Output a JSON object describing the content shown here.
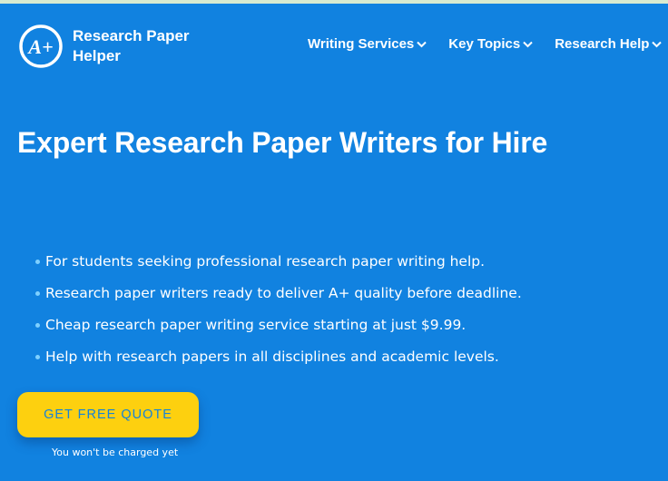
{
  "logo": {
    "mark_text": "A+",
    "name_line1": "Research Paper",
    "name_line2": "Helper"
  },
  "nav": {
    "items": [
      {
        "label": "Writing Services"
      },
      {
        "label": "Key Topics"
      },
      {
        "label": "Research Help"
      }
    ]
  },
  "hero": {
    "title": "Expert Research Paper Writers for Hire",
    "bullets": [
      "For students seeking professional research paper writing help.",
      "Research paper writers ready to deliver A+ quality before deadline.",
      "Cheap research paper writing service starting at just $9.99.",
      "Help with research papers in all disciplines and academic levels."
    ],
    "cta_label": "GET FREE QUOTE",
    "cta_note": "You won't be charged yet"
  },
  "colors": {
    "background": "#1182e0",
    "cta": "#fdd00f",
    "cta_text": "#1582d8",
    "bullet": "#7fd0ff"
  }
}
